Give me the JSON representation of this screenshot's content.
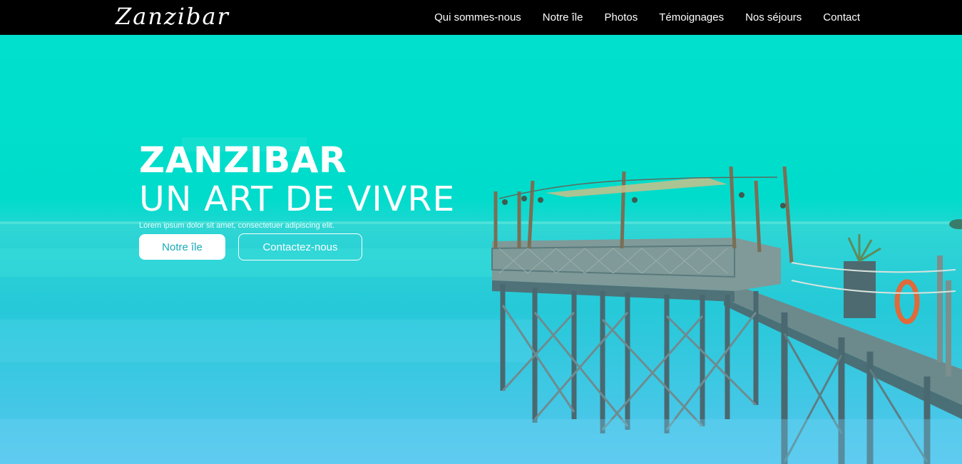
{
  "brand": {
    "logo": "Zanzibar"
  },
  "nav": {
    "items": [
      {
        "label": "Qui sommes-nous"
      },
      {
        "label": "Notre île"
      },
      {
        "label": "Photos"
      },
      {
        "label": "Témoignages"
      },
      {
        "label": "Nos séjours"
      },
      {
        "label": "Contact"
      }
    ]
  },
  "hero": {
    "title": "ZANZIBAR",
    "subtitle": "UN ART DE VIVRE",
    "description": "Lorem ipsum dolor sit amet, consectetuer adipiscing elit.",
    "primary_button": "Notre île",
    "secondary_button": "Contactez-nous"
  },
  "colors": {
    "navbar": "#000000",
    "sky": "#00e0cc",
    "sea": "#36c7e6",
    "primary_button_text": "#18a9b5"
  }
}
